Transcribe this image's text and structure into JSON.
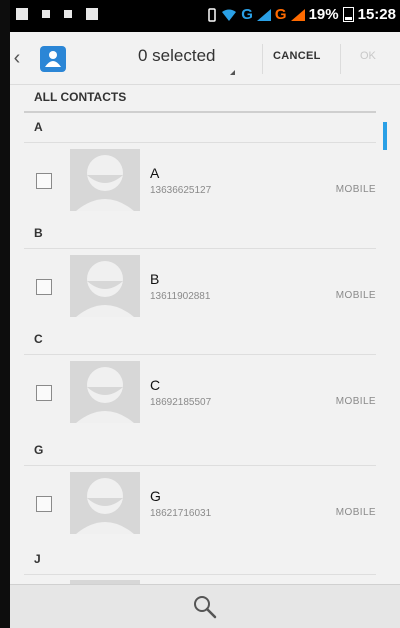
{
  "status_bar": {
    "network_1": "G",
    "network_2": "G",
    "battery": "19%",
    "time": "15:28"
  },
  "action_bar": {
    "selected_label": "0 selected",
    "cancel_label": "CANCEL",
    "ok_label": "OK"
  },
  "list": {
    "all_contacts_label": "ALL CONTACTS",
    "sections": [
      {
        "letter": "A",
        "contact": {
          "name": "A",
          "number": "13636625127",
          "type": "MOBILE"
        }
      },
      {
        "letter": "B",
        "contact": {
          "name": "B",
          "number": "13611902881",
          "type": "MOBILE"
        }
      },
      {
        "letter": "C",
        "contact": {
          "name": "C",
          "number": "18692185507",
          "type": "MOBILE"
        }
      },
      {
        "letter": "G",
        "contact": {
          "name": "G",
          "number": "18621716031",
          "type": "MOBILE"
        }
      },
      {
        "letter": "J"
      }
    ]
  },
  "colors": {
    "accent": "#2aa0e6",
    "network_2": "#ff6a00",
    "app_icon": "#2b86d6"
  },
  "icons": [
    "back-icon",
    "contacts-app-icon",
    "checkbox-icon",
    "avatar-icon",
    "search-icon"
  ]
}
